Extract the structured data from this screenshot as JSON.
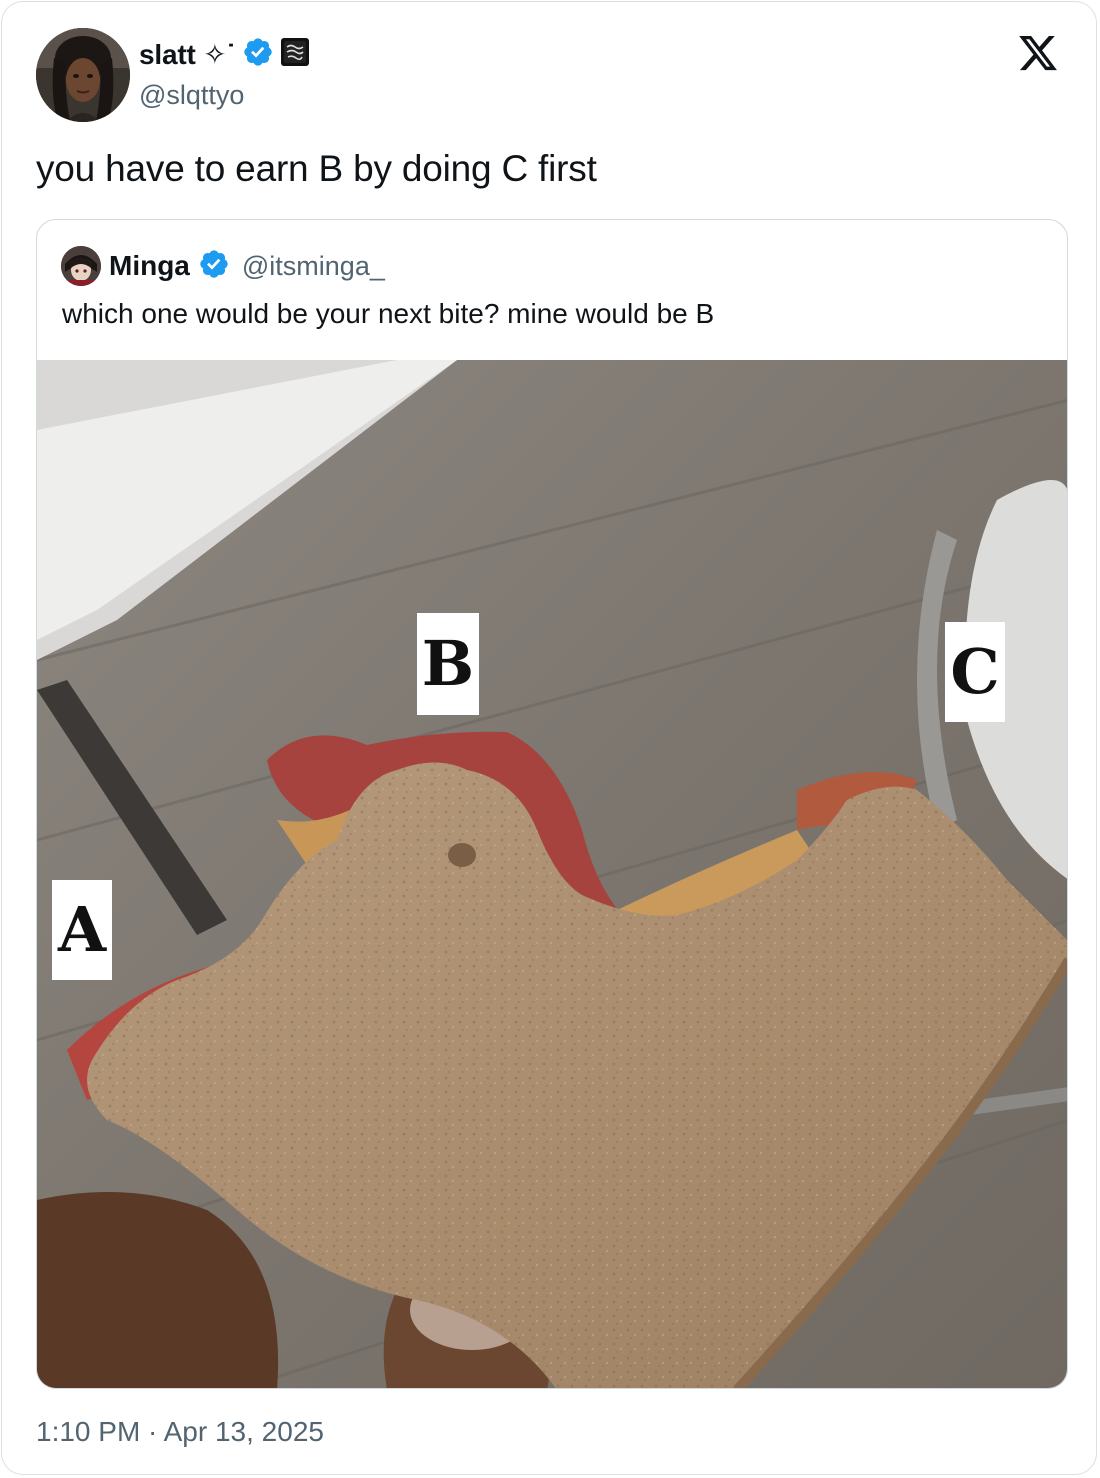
{
  "tweet": {
    "author": {
      "display_name": "slatt ✧˙",
      "handle": "@slqttyo",
      "verified": true,
      "affiliation_badge_icon": "affiliate-badge-icon"
    },
    "text": "you have to earn B by doing C first",
    "timestamp": "1:10 PM · Apr 13, 2025"
  },
  "quoted_tweet": {
    "author": {
      "display_name": "Minga",
      "handle": "@itsminga_",
      "verified": true
    },
    "text": "which one would be your next bite? mine would be B",
    "image": {
      "description_icon": "sandwich-photo",
      "labels": [
        "A",
        "B",
        "C"
      ]
    }
  },
  "brand": {
    "logo_icon": "x-logo-icon",
    "verified_color": "#1d9bf0",
    "secondary_text_color": "#536471"
  }
}
